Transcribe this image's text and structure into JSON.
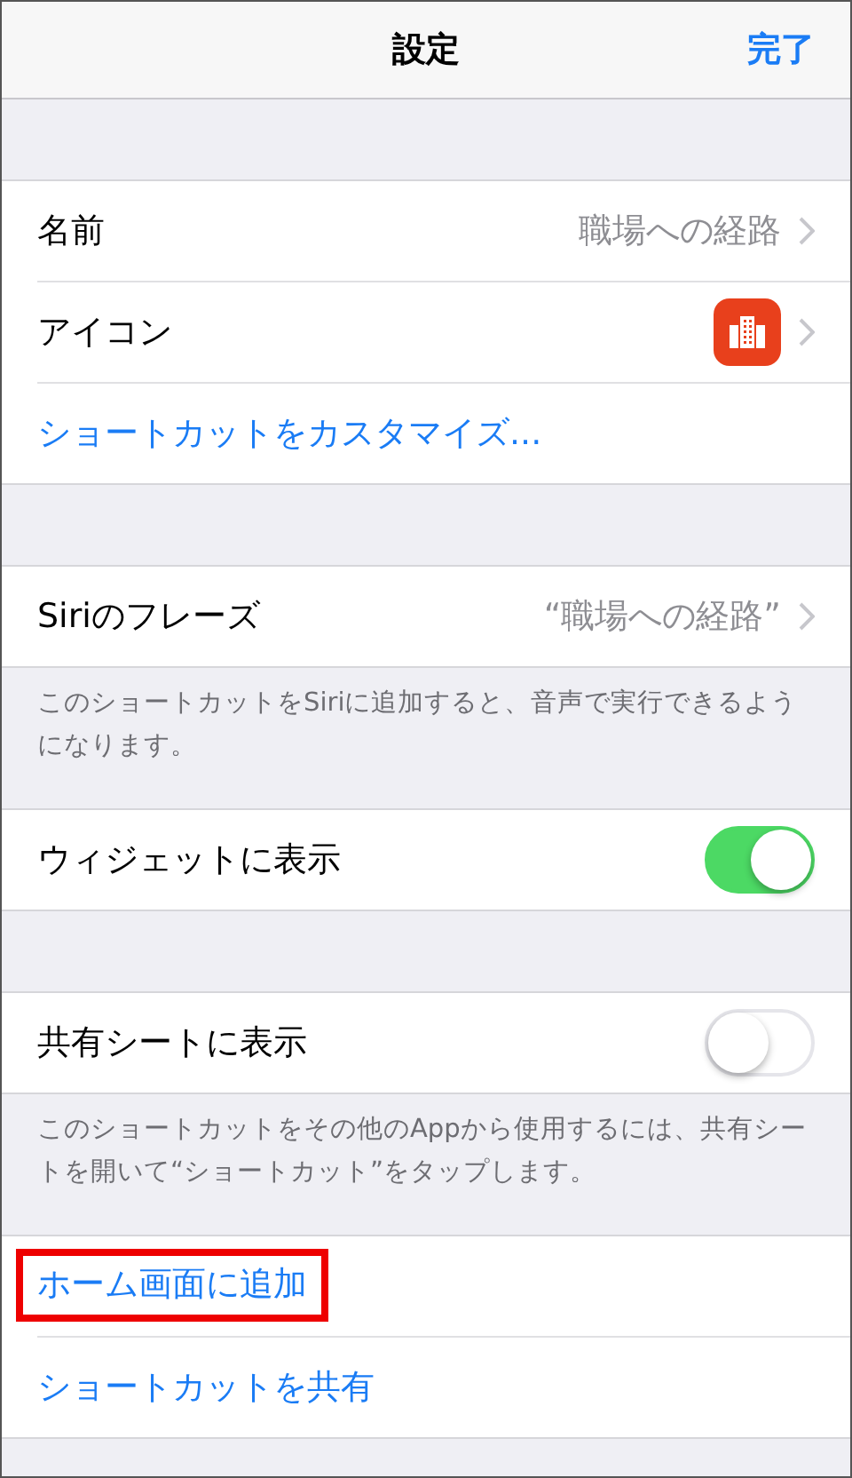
{
  "nav": {
    "title": "設定",
    "done": "完了"
  },
  "sections": [
    {
      "rows": [
        {
          "kind": "detail",
          "label": "名前",
          "value": "職場への経路"
        },
        {
          "kind": "icon",
          "label": "アイコン",
          "color": "#e8401c"
        },
        {
          "kind": "link",
          "label": "ショートカットをカスタマイズ...",
          "highlighted": false
        }
      ]
    },
    {
      "rows": [
        {
          "kind": "detail",
          "label": "Siriのフレーズ",
          "value": "“職場への経路”"
        }
      ],
      "footer": "このショートカットをSiriに追加すると、音声で実行できるようになります。"
    },
    {
      "rows": [
        {
          "kind": "toggle",
          "label": "ウィジェットに表示",
          "on": true
        }
      ]
    },
    {
      "rows": [
        {
          "kind": "toggle",
          "label": "共有シートに表示",
          "on": false
        }
      ],
      "footer": "このショートカットをその他のAppから使用するには、共有シートを開いて“ショートカット”をタップします。"
    },
    {
      "rows": [
        {
          "kind": "link",
          "label": "ホーム画面に追加",
          "highlighted": true
        },
        {
          "kind": "link",
          "label": "ショートカットを共有",
          "highlighted": false
        }
      ]
    }
  ]
}
